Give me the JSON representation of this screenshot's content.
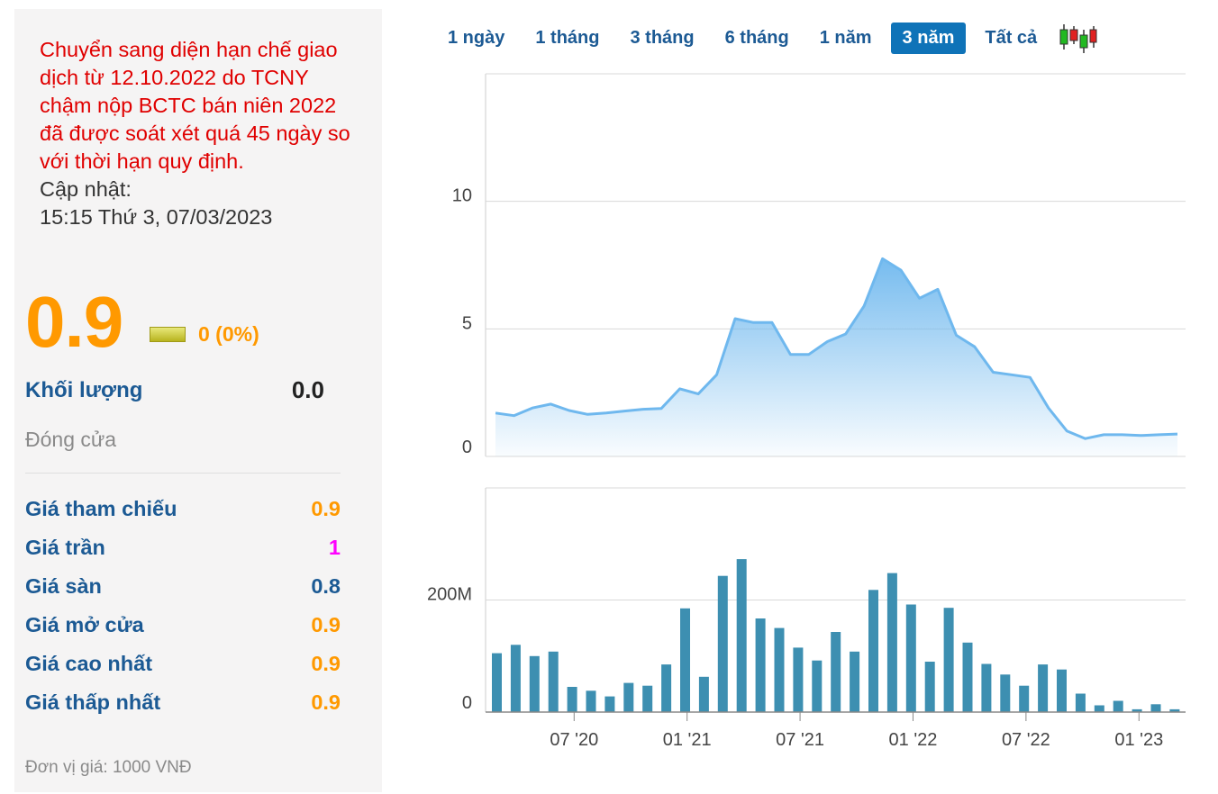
{
  "notice": "Chuyển sang diện hạn chế giao dịch từ 12.10.2022 do TCNY chậm nộp BCTC bán niên 2022 đã được soát xét quá 45 ngày so với thời hạn quy định.",
  "updated_label": "Cập nhật:",
  "updated_time": "15:15 Thứ 3, 07/03/2023",
  "price": "0.9",
  "change": "0 (0%)",
  "volume_label": "Khối lượng",
  "volume_value": "0.0",
  "status": "Đóng cửa",
  "stats": [
    {
      "label": "Giá tham chiếu",
      "value": "0.9",
      "color": "#ff9900"
    },
    {
      "label": "Giá trần",
      "value": "1",
      "color": "#ff00ff"
    },
    {
      "label": "Giá sàn",
      "value": "0.8",
      "color": "#1c5a94"
    },
    {
      "label": "Giá mở cửa",
      "value": "0.9",
      "color": "#ff9900"
    },
    {
      "label": "Giá cao nhất",
      "value": "0.9",
      "color": "#ff9900"
    },
    {
      "label": "Giá thấp nhất",
      "value": "0.9",
      "color": "#ff9900"
    }
  ],
  "unit": "Đơn vị giá: 1000 VNĐ",
  "ranges": {
    "items": [
      "1 ngày",
      "1 tháng",
      "3 tháng",
      "6 tháng",
      "1 năm",
      "3 năm",
      "Tất cả"
    ],
    "active": "3 năm",
    "candle_icon": "candlestick-icon"
  },
  "colors": {
    "accent": "#0f73b8",
    "price_line": "#6fb8ee",
    "volume_bar": "#3d8fb1",
    "label_blue": "#1c5a94",
    "orange": "#ff9900",
    "red": "#e00000"
  },
  "chart_data": [
    {
      "type": "area",
      "x": [
        0,
        1,
        2,
        3,
        4,
        5,
        6,
        7,
        8,
        9,
        10,
        11,
        12,
        13,
        14,
        15,
        16,
        17,
        18,
        19,
        20,
        21,
        22,
        23,
        24,
        25,
        26,
        27,
        28,
        29,
        30,
        31,
        32,
        33,
        34,
        35,
        36,
        37
      ],
      "values": [
        1.7,
        1.6,
        1.9,
        2.05,
        1.8,
        1.65,
        1.7,
        1.78,
        1.85,
        1.88,
        2.65,
        2.45,
        3.2,
        5.4,
        5.25,
        5.25,
        4.0,
        4.0,
        4.5,
        4.8,
        5.9,
        7.75,
        7.3,
        6.2,
        6.55,
        4.75,
        4.3,
        3.3,
        3.2,
        3.1,
        1.9,
        1.0,
        0.7,
        0.85,
        0.85,
        0.82,
        0.85,
        0.88
      ],
      "yticks": [
        "0",
        "5",
        "10"
      ],
      "ylim": [
        0,
        15
      ],
      "grid": true
    },
    {
      "type": "bar",
      "values": [
        105,
        120,
        100,
        108,
        45,
        38,
        28,
        52,
        47,
        85,
        185,
        63,
        243,
        273,
        167,
        150,
        115,
        92,
        143,
        108,
        218,
        248,
        192,
        90,
        186,
        124,
        86,
        67,
        47,
        85,
        76,
        33,
        12,
        20,
        5,
        14,
        5
      ],
      "yticks": [
        "0",
        "200M"
      ],
      "ylim": [
        0,
        400
      ],
      "xticks": [
        "07 '20",
        "01 '21",
        "07 '21",
        "01 '22",
        "07 '22",
        "01 '23"
      ],
      "xtick_positions": [
        4.2,
        10.2,
        16.2,
        22.2,
        28.2,
        34.2
      ],
      "grid": true
    }
  ]
}
